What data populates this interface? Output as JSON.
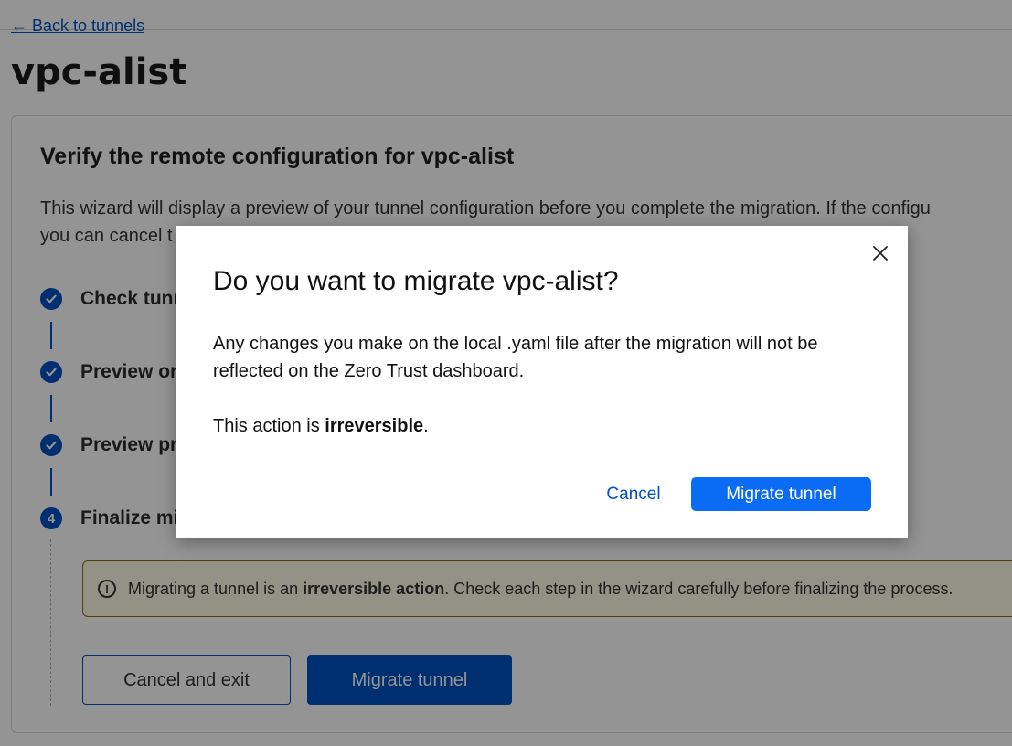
{
  "page": {
    "back_link": "← Back to tunnels",
    "title": "vpc-alist"
  },
  "card": {
    "heading": "Verify the remote configuration for vpc-alist",
    "description_line1": "This wizard will display a preview of your tunnel configuration before you complete the migration. If the configu",
    "description_line2": "you can cancel t"
  },
  "steps": [
    {
      "label": "Check tunn",
      "status": "complete"
    },
    {
      "label": "Preview or",
      "status": "complete"
    },
    {
      "label": "Preview pr",
      "status": "complete"
    },
    {
      "number": "4",
      "label": "Finalize mi",
      "status": "current"
    }
  ],
  "warning": {
    "text_before": "Migrating a tunnel is an ",
    "text_bold": "irreversible action",
    "text_after": ". Check each step in the wizard carefully before finalizing the process."
  },
  "actions": {
    "cancel_exit_label": "Cancel and exit",
    "migrate_label": "Migrate tunnel"
  },
  "modal": {
    "title": "Do you want to migrate vpc-alist?",
    "body": "Any changes you make on the local .yaml file after the migration will not be reflected on the Zero Trust dashboard.",
    "irreversible_prefix": "This action is ",
    "irreversible_bold": "irreversible",
    "irreversible_suffix": ".",
    "cancel_label": "Cancel",
    "confirm_label": "Migrate tunnel"
  },
  "colors": {
    "accent": "#0051c3",
    "modal_button": "#0a6cf5",
    "warning_bg": "#fffbe6",
    "overlay": "rgba(0,0,0,0.42)"
  },
  "icons": {
    "step_complete": "check-circle-icon",
    "warning": "exclamation-circle-icon",
    "close": "close-icon"
  }
}
